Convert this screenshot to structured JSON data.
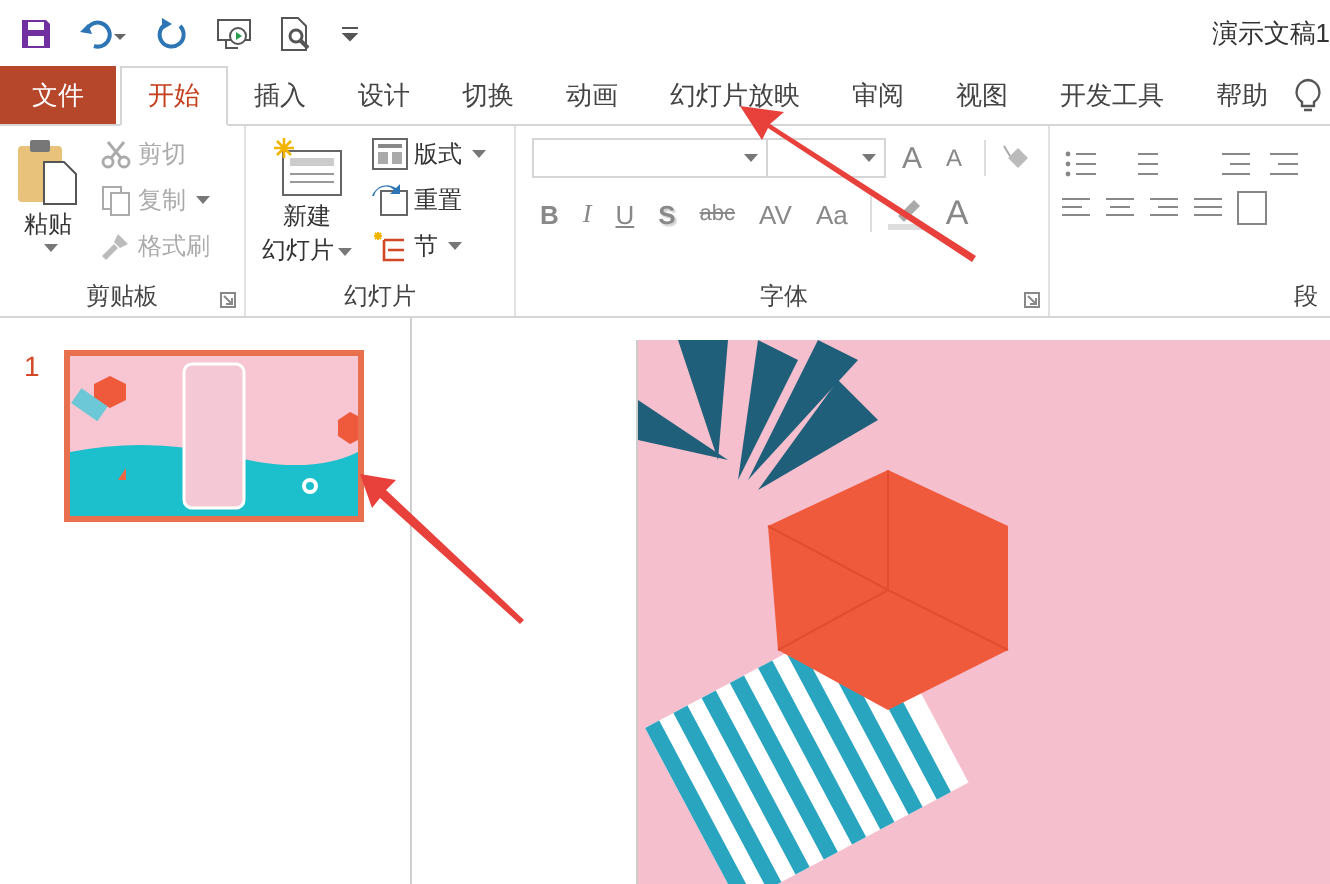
{
  "window": {
    "title": "演示文稿1"
  },
  "tabs": [
    {
      "label": "文件",
      "kind": "file",
      "selected": false
    },
    {
      "label": "开始",
      "kind": "tab",
      "selected": true
    },
    {
      "label": "插入",
      "kind": "tab",
      "selected": false
    },
    {
      "label": "设计",
      "kind": "tab",
      "selected": false
    },
    {
      "label": "切换",
      "kind": "tab",
      "selected": false
    },
    {
      "label": "动画",
      "kind": "tab",
      "selected": false
    },
    {
      "label": "幻灯片放映",
      "kind": "tab",
      "selected": false
    },
    {
      "label": "审阅",
      "kind": "tab",
      "selected": false
    },
    {
      "label": "视图",
      "kind": "tab",
      "selected": false
    },
    {
      "label": "开发工具",
      "kind": "tab",
      "selected": false
    },
    {
      "label": "帮助",
      "kind": "tab",
      "selected": false
    }
  ],
  "clipboard": {
    "label": "剪贴板",
    "paste": {
      "label": "粘贴",
      "disabled": false
    },
    "items": [
      {
        "label": "剪切",
        "kind": "cut",
        "disabled": true
      },
      {
        "label": "复制",
        "kind": "copy",
        "disabled": true
      },
      {
        "label": "格式刷",
        "kind": "painter",
        "disabled": true
      }
    ]
  },
  "slides_group": {
    "label": "幻灯片",
    "new_slide": {
      "lines": [
        "新建",
        "幻灯片"
      ]
    },
    "items": [
      {
        "label": "版式",
        "kind": "layout"
      },
      {
        "label": "重置",
        "kind": "reset"
      },
      {
        "label": "节",
        "kind": "section"
      }
    ]
  },
  "font_group": {
    "label": "字体",
    "size_buttons": [
      {
        "label": "A",
        "kind": "grow",
        "disabled": true
      },
      {
        "label": "A",
        "kind": "shrink",
        "disabled": true
      }
    ],
    "format_buttons": [
      {
        "label": "B",
        "kind": "bold",
        "disabled": true
      },
      {
        "label": "I",
        "kind": "italic",
        "disabled": true
      },
      {
        "label": "U",
        "kind": "underline",
        "disabled": true
      },
      {
        "label": "S",
        "kind": "shadow",
        "disabled": true
      },
      {
        "label": "abc",
        "kind": "strike",
        "disabled": true
      },
      {
        "label": "AV",
        "kind": "spacing",
        "disabled": true
      },
      {
        "label": "Aa",
        "kind": "case",
        "disabled": true
      }
    ],
    "color_button": {
      "label": "A",
      "disabled": true
    }
  },
  "paragraph_group": {
    "label": "段"
  },
  "slides": [
    {
      "number": "1",
      "selected": true
    }
  ]
}
